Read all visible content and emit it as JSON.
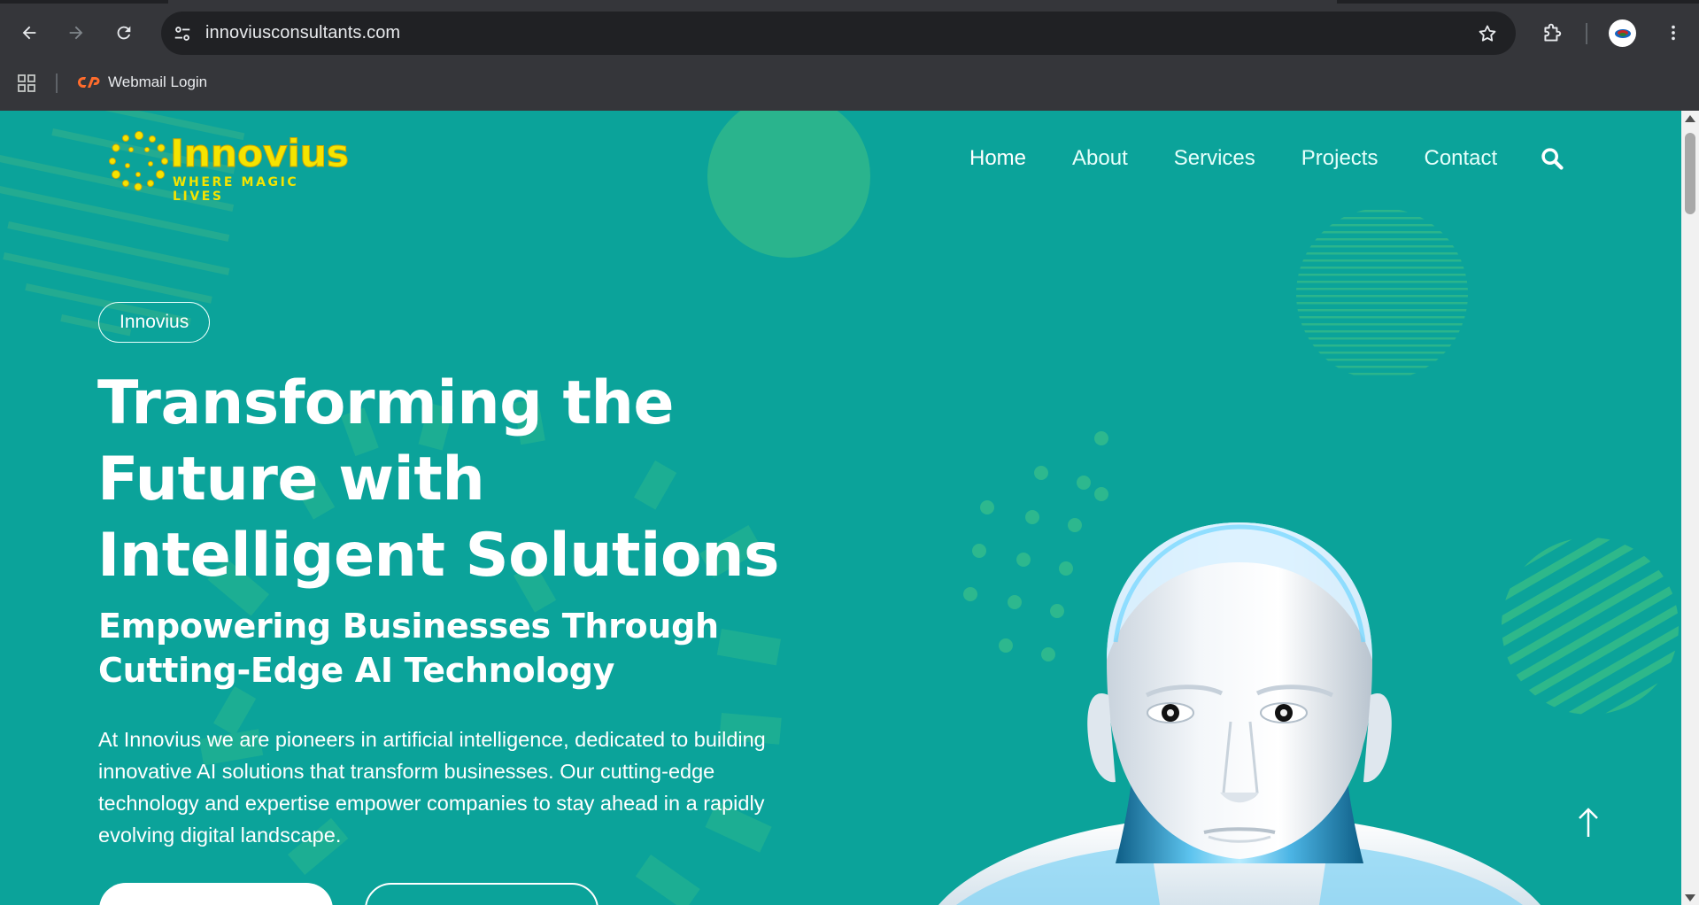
{
  "browser": {
    "url": "innoviusconsultants.com",
    "bookmarks": [
      {
        "label": "Webmail Login",
        "icon": "cpanel-icon"
      }
    ]
  },
  "site": {
    "logo": {
      "name": "Innovius",
      "tagline": "WHERE MAGIC LIVES"
    },
    "nav": {
      "home": "Home",
      "about": "About",
      "services": "Services",
      "projects": "Projects",
      "contact": "Contact",
      "active": "Home"
    },
    "hero": {
      "badge": "Innovius",
      "title": "Transforming the Future with Intelligent Solutions",
      "subtitle": "Empowering Businesses Through Cutting-Edge AI Technology",
      "description": "At Innovius we are pioneers in artificial intelligence, dedicated to building innovative AI solutions that transform businesses. Our cutting-edge technology and expertise empower companies to stay ahead in a rapidly evolving digital landscape."
    }
  },
  "colors": {
    "background": "#0ba39a",
    "logo_yellow": "#f5e400",
    "decor_green": "#2eb88a",
    "chrome": "#35363a"
  }
}
